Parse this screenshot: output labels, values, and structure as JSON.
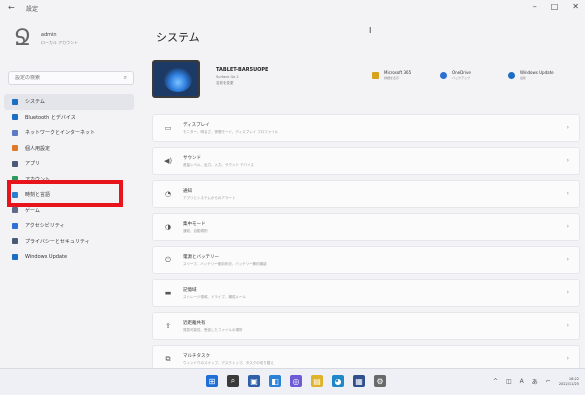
{
  "window": {
    "app_title": "設定",
    "controls": [
      "–",
      "□",
      "✕"
    ]
  },
  "profile": {
    "name": "admin",
    "email": "ローカル アカウント"
  },
  "search": {
    "placeholder": "設定の検索"
  },
  "sidebar": {
    "items": [
      {
        "label": "システム",
        "icon": "system-icon",
        "color": "#1b6ec2",
        "active": true
      },
      {
        "label": "Bluetooth とデバイス",
        "icon": "bluetooth-icon",
        "color": "#1b6ec2"
      },
      {
        "label": "ネットワークとインターネット",
        "icon": "network-icon",
        "color": "#5b7bc4"
      },
      {
        "label": "個人用設定",
        "icon": "personalization-icon",
        "color": "#e07a2b"
      },
      {
        "label": "アプリ",
        "icon": "apps-icon",
        "color": "#4a5a78"
      },
      {
        "label": "アカウント",
        "icon": "accounts-icon",
        "color": "#2c9b5d"
      },
      {
        "label": "時刻と言語",
        "icon": "time-language-icon",
        "color": "#2b7fd1"
      },
      {
        "label": "ゲーム",
        "icon": "gaming-icon",
        "color": "#5b6b88"
      },
      {
        "label": "アクセシビリティ",
        "icon": "accessibility-icon",
        "color": "#2e6fd8"
      },
      {
        "label": "プライバシーとセキュリティ",
        "icon": "privacy-icon",
        "color": "#4a5a78"
      },
      {
        "label": "Windows Update",
        "icon": "windows-update-icon",
        "color": "#1b6ec2"
      }
    ]
  },
  "main": {
    "title": "システム",
    "device": {
      "name": "TABLET-BAR5UOPE",
      "model": "Surface Go 2",
      "rename": "名前を変更"
    },
    "quick": [
      {
        "title": "Microsoft 365",
        "sub": "詳細を表示",
        "color": "#d8a21c"
      },
      {
        "title": "OneDrive",
        "sub": "バックアップ",
        "color": "#2a6fd1"
      },
      {
        "title": "Windows Update",
        "sub": "最新",
        "color": "#1b6ec2"
      }
    ],
    "cards": [
      {
        "icon": "display-icon",
        "glyph": "▭",
        "title": "ディスプレイ",
        "sub": "モニター、明るさ、夜間モード、ディスプレイ プロファイル"
      },
      {
        "icon": "sound-icon",
        "glyph": "◀)",
        "title": "サウンド",
        "sub": "音量レベル、出力、入力、サウンド デバイス"
      },
      {
        "icon": "notifications-icon",
        "glyph": "◔",
        "title": "通知",
        "sub": "アプリとシステムからのアラート"
      },
      {
        "icon": "focus-icon",
        "glyph": "◑",
        "title": "集中モード",
        "sub": "通知、自動規則"
      },
      {
        "icon": "power-icon",
        "glyph": "⏻",
        "title": "電源とバッテリー",
        "sub": "スリープ、バッテリー使用状況、バッテリー節約機能"
      },
      {
        "icon": "storage-icon",
        "glyph": "▬",
        "title": "記憶域",
        "sub": "ストレージ領域、ドライブ、構成ルール"
      },
      {
        "icon": "nearby-sharing-icon",
        "glyph": "⇪",
        "title": "近距離共有",
        "sub": "発見可能性、受信したファイルの場所"
      },
      {
        "icon": "multitasking-icon",
        "glyph": "⧉",
        "title": "マルチタスク",
        "sub": "ウィンドウのスナップ、デスクトップ、タスクの切り替え"
      }
    ]
  },
  "taskbar": {
    "icons": [
      {
        "name": "start-icon",
        "glyph": "⊞",
        "color": "#1d6fd6"
      },
      {
        "name": "search-icon",
        "glyph": "⌕",
        "color": "#3a3a3a"
      },
      {
        "name": "task-view-icon",
        "glyph": "▣",
        "color": "#2f5fa8"
      },
      {
        "name": "widgets-icon",
        "glyph": "◧",
        "color": "#2a82d6"
      },
      {
        "name": "chat-icon",
        "glyph": "◎",
        "color": "#6b5bd6"
      },
      {
        "name": "file-explorer-icon",
        "glyph": "▤",
        "color": "#e0b12a"
      },
      {
        "name": "edge-icon",
        "glyph": "◕",
        "color": "#1e88c8"
      },
      {
        "name": "store-icon",
        "glyph": "▦",
        "color": "#2f4f8f"
      },
      {
        "name": "settings-icon",
        "glyph": "⚙",
        "color": "#6a6a6a"
      }
    ],
    "tray": [
      "^",
      "◫",
      "A",
      "あ",
      "⌐"
    ],
    "time": "16:22",
    "date": "2022/11/25"
  }
}
